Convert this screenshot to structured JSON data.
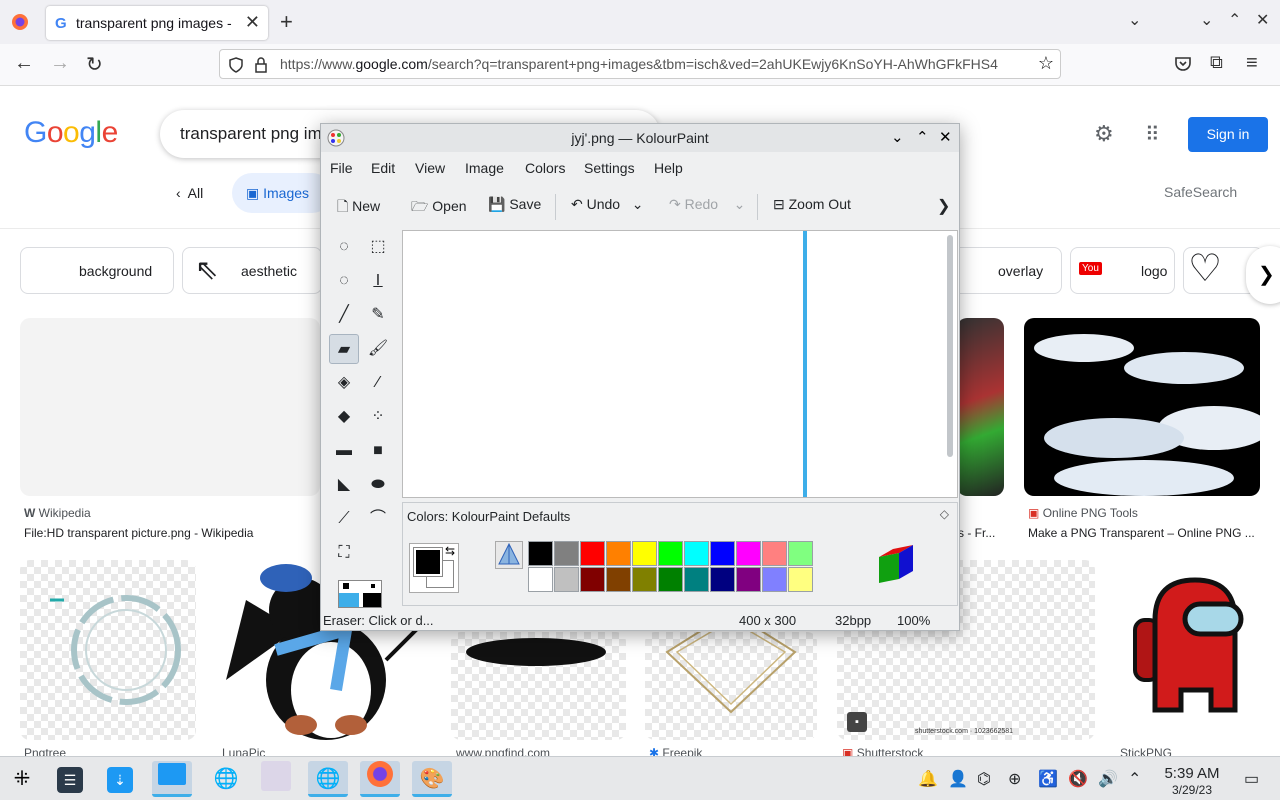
{
  "browser": {
    "tab_title": "transparent png images - ",
    "tab_google_letter": "G",
    "tab_close": "✕",
    "new_tab": "+",
    "url_prefix": "https://www.",
    "url_host": "google.com",
    "url_rest": "/search?q=transparent+png+images&tbm=isch&ved=2ahUKEwjy6KnSoYH-AhWhGFkFHS4"
  },
  "google": {
    "logo": [
      "G",
      "o",
      "o",
      "g",
      "l",
      "e"
    ],
    "logo_colors": [
      "#4285f4",
      "#ea4335",
      "#fbbc05",
      "#4285f4",
      "#34a853",
      "#ea4335"
    ],
    "search_text": "transparent png im",
    "signin": "Sign in",
    "filter_all": "All",
    "filter_images": "Images",
    "safesearch": "SafeSearch",
    "chips": [
      "background",
      "aesthetic",
      "overlay",
      "logo"
    ],
    "results": [
      {
        "source": "Wikipedia",
        "source_icon": "W",
        "title": "File:HD transparent picture.png - Wikipedia"
      },
      {
        "source": "Online PNG Tools",
        "title": "Make a PNG Transparent – Online PNG ..."
      },
      {
        "partial_title": "s - Fr..."
      },
      {
        "source": "Pngtree"
      },
      {
        "source": "LunaPic"
      },
      {
        "source": "www.pngfind.com"
      },
      {
        "source": "Freepik"
      },
      {
        "source": "Shutterstock"
      },
      {
        "source": "StickPNG"
      }
    ],
    "shutterstock_watermark": "shutterstock.com · 1023662581"
  },
  "kolourpaint": {
    "title": "jyj'.png — KolourPaint",
    "menu": [
      "File",
      "Edit",
      "View",
      "Image",
      "Colors",
      "Settings",
      "Help"
    ],
    "toolbar": {
      "new": "New",
      "open": "Open",
      "save": "Save",
      "undo": "Undo",
      "redo": "Redo",
      "zoom_out": "Zoom Out"
    },
    "colors_label": "Colors: KolourPaint Defaults",
    "palette_row1": [
      "#000000",
      "#808080",
      "#ff0000",
      "#ff8000",
      "#ffff00",
      "#00ff00",
      "#00ffff",
      "#0000ff",
      "#ff00ff",
      "#ff8080",
      "#80ff80"
    ],
    "palette_row2": [
      "#ffffff",
      "#c0c0c0",
      "#800000",
      "#804000",
      "#808000",
      "#008000",
      "#008080",
      "#000080",
      "#800080",
      "#8080ff",
      "#ffff80"
    ],
    "status_tool": "Eraser: Click or d...",
    "status_size": "400 x 300",
    "status_depth": "32bpp",
    "status_zoom": "100%"
  },
  "taskbar": {
    "time": "5:39 AM",
    "date": "3/29/23"
  }
}
